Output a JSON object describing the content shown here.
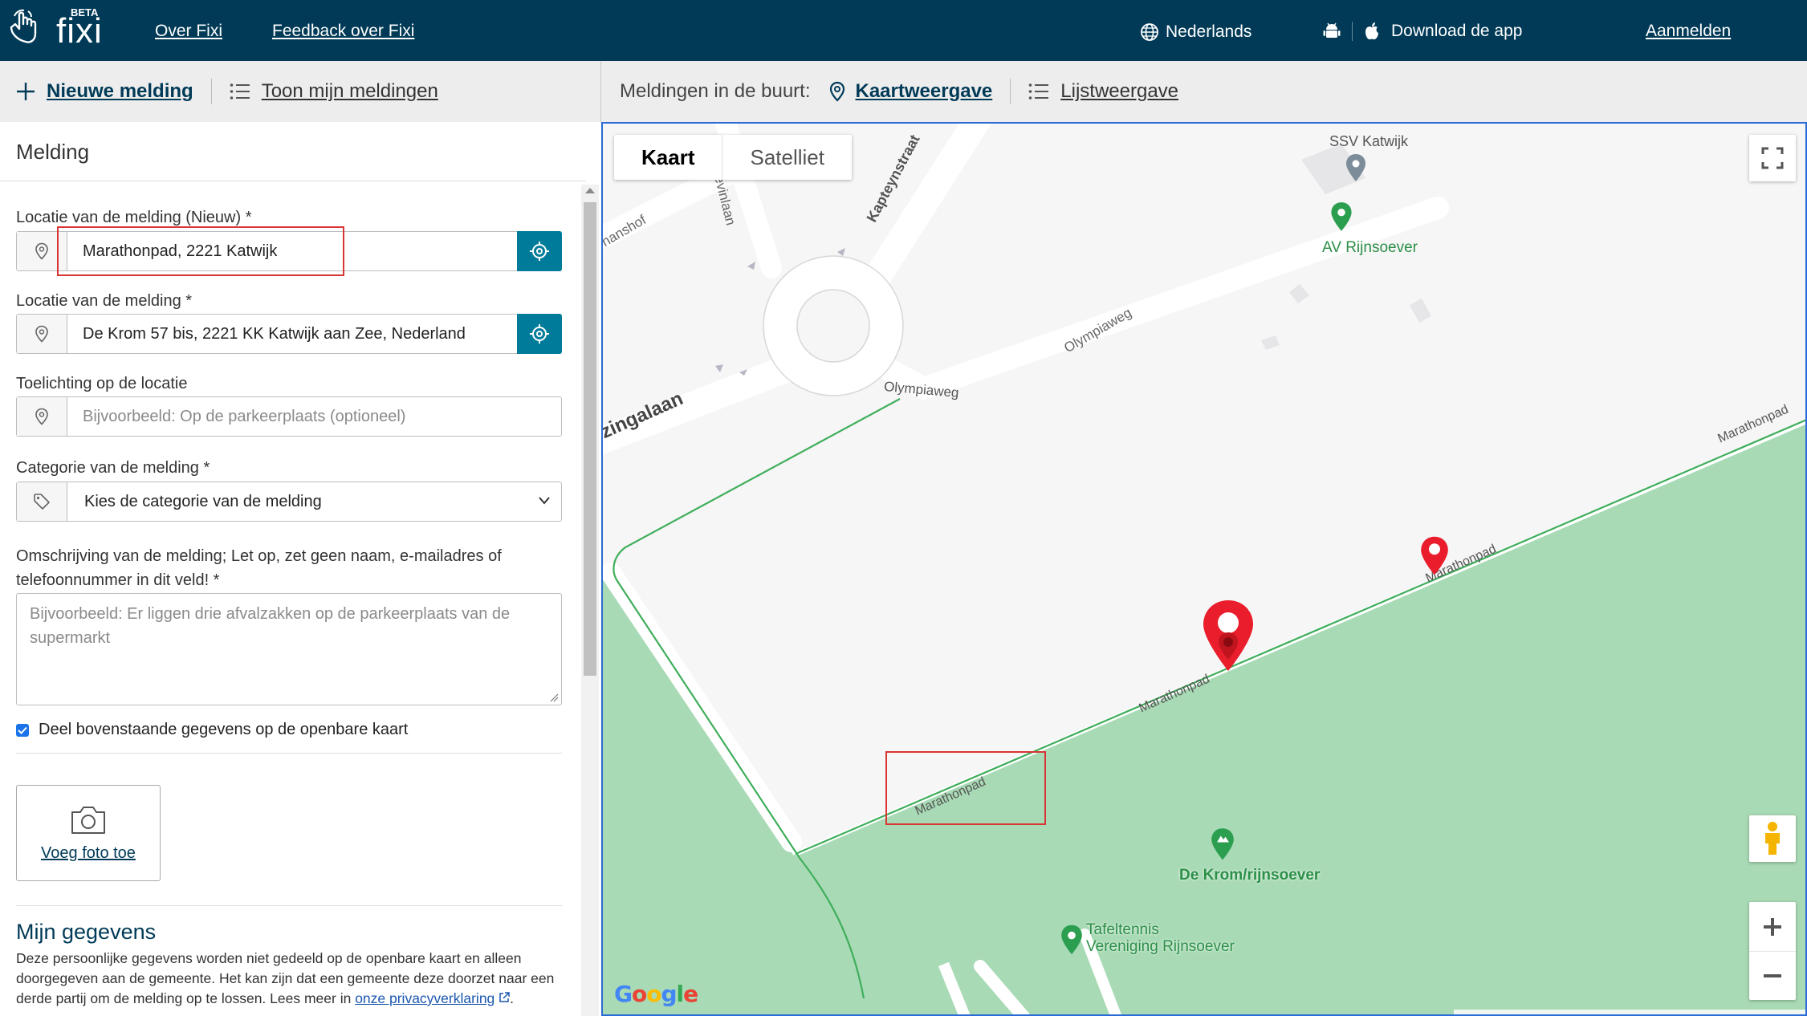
{
  "header": {
    "logo_text": "fixi",
    "logo_badge": "BETA",
    "nav": [
      "Over Fixi",
      "Feedback over Fixi"
    ],
    "language": "Nederlands",
    "download": "Download de app",
    "login": "Aanmelden"
  },
  "toolbar": {
    "new_report": "Nieuwe melding",
    "my_reports": "Toon mijn meldingen",
    "nearby_label": "Meldingen in de buurt:",
    "map_view": "Kaartweergave",
    "list_view": "Lijstweergave"
  },
  "form": {
    "title": "Melding",
    "location_new_label": "Locatie van de melding (Nieuw) *",
    "location_new_value": "Marathonpad, 2221 Katwijk",
    "location_label": "Locatie van de melding *",
    "location_value": "De Krom 57 bis, 2221 KK Katwijk aan Zee, Nederland",
    "location_note_label": "Toelichting op de locatie",
    "location_note_placeholder": "Bijvoorbeeld: Op de parkeerplaats (optioneel)",
    "category_label": "Categorie van de melding *",
    "category_value": "Kies de categorie van de melding",
    "description_label": "Omschrijving van de melding; Let op, zet geen naam, e-mailadres of telefoonnummer in dit veld! *",
    "description_placeholder": "Bijvoorbeeld: Er liggen drie afvalzakken op de parkeerplaats van de supermarkt",
    "share_checkbox": "Deel bovenstaande gegevens op de openbare kaart",
    "share_checked": true,
    "add_photo": "Voeg foto toe",
    "my_details_title": "Mijn gegevens",
    "my_details_text": "Deze persoonlijke gegevens worden niet gedeeld op de openbare kaart en alleen doorgegeven aan de gemeente. Het kan zijn dat een gemeente deze doorzet naar een derde partij om de melding op te lossen. Lees meer in ",
    "privacy_link": "onze privacyverklaring",
    "privacy_suffix": "."
  },
  "map": {
    "type_map": "Kaart",
    "type_satellite": "Satelliet",
    "google": "Google",
    "streets": {
      "kapteynstraat": "Kapteynstraat",
      "stevinlaan": "Stevinlaan",
      "hanshof": "hanshof",
      "zingalaan": "zingalaan",
      "olympiaweg_1": "Olympiaweg",
      "olympiaweg_2": "Olympiaweg",
      "marathonpad_1": "Marathonpad",
      "marathonpad_2": "Marathonpad",
      "marathonpad_3": "Marathonpad",
      "marathonpad_4": "Marathonpad"
    },
    "places": {
      "ssv": "SSV Katwijk",
      "av": "AV Rijnsoever",
      "krom": "De Krom/rijnsoever",
      "tt_1": "Tafeltennis",
      "tt_2": "Vereniging Rijnsoever"
    }
  },
  "colors": {
    "header_bg": "#003a57",
    "accent": "#007c9a",
    "park_green": "#a8dab5",
    "marker_red": "#ea1d2c"
  }
}
